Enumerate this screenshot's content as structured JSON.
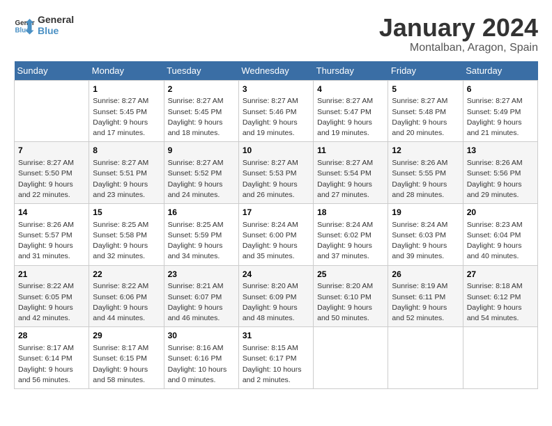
{
  "header": {
    "logo_line1": "General",
    "logo_line2": "Blue",
    "month_year": "January 2024",
    "location": "Montalban, Aragon, Spain"
  },
  "weekdays": [
    "Sunday",
    "Monday",
    "Tuesday",
    "Wednesday",
    "Thursday",
    "Friday",
    "Saturday"
  ],
  "weeks": [
    [
      {
        "day": "",
        "info": ""
      },
      {
        "day": "1",
        "info": "Sunrise: 8:27 AM\nSunset: 5:45 PM\nDaylight: 9 hours\nand 17 minutes."
      },
      {
        "day": "2",
        "info": "Sunrise: 8:27 AM\nSunset: 5:45 PM\nDaylight: 9 hours\nand 18 minutes."
      },
      {
        "day": "3",
        "info": "Sunrise: 8:27 AM\nSunset: 5:46 PM\nDaylight: 9 hours\nand 19 minutes."
      },
      {
        "day": "4",
        "info": "Sunrise: 8:27 AM\nSunset: 5:47 PM\nDaylight: 9 hours\nand 19 minutes."
      },
      {
        "day": "5",
        "info": "Sunrise: 8:27 AM\nSunset: 5:48 PM\nDaylight: 9 hours\nand 20 minutes."
      },
      {
        "day": "6",
        "info": "Sunrise: 8:27 AM\nSunset: 5:49 PM\nDaylight: 9 hours\nand 21 minutes."
      }
    ],
    [
      {
        "day": "7",
        "info": "Sunrise: 8:27 AM\nSunset: 5:50 PM\nDaylight: 9 hours\nand 22 minutes."
      },
      {
        "day": "8",
        "info": "Sunrise: 8:27 AM\nSunset: 5:51 PM\nDaylight: 9 hours\nand 23 minutes."
      },
      {
        "day": "9",
        "info": "Sunrise: 8:27 AM\nSunset: 5:52 PM\nDaylight: 9 hours\nand 24 minutes."
      },
      {
        "day": "10",
        "info": "Sunrise: 8:27 AM\nSunset: 5:53 PM\nDaylight: 9 hours\nand 26 minutes."
      },
      {
        "day": "11",
        "info": "Sunrise: 8:27 AM\nSunset: 5:54 PM\nDaylight: 9 hours\nand 27 minutes."
      },
      {
        "day": "12",
        "info": "Sunrise: 8:26 AM\nSunset: 5:55 PM\nDaylight: 9 hours\nand 28 minutes."
      },
      {
        "day": "13",
        "info": "Sunrise: 8:26 AM\nSunset: 5:56 PM\nDaylight: 9 hours\nand 29 minutes."
      }
    ],
    [
      {
        "day": "14",
        "info": "Sunrise: 8:26 AM\nSunset: 5:57 PM\nDaylight: 9 hours\nand 31 minutes."
      },
      {
        "day": "15",
        "info": "Sunrise: 8:25 AM\nSunset: 5:58 PM\nDaylight: 9 hours\nand 32 minutes."
      },
      {
        "day": "16",
        "info": "Sunrise: 8:25 AM\nSunset: 5:59 PM\nDaylight: 9 hours\nand 34 minutes."
      },
      {
        "day": "17",
        "info": "Sunrise: 8:24 AM\nSunset: 6:00 PM\nDaylight: 9 hours\nand 35 minutes."
      },
      {
        "day": "18",
        "info": "Sunrise: 8:24 AM\nSunset: 6:02 PM\nDaylight: 9 hours\nand 37 minutes."
      },
      {
        "day": "19",
        "info": "Sunrise: 8:24 AM\nSunset: 6:03 PM\nDaylight: 9 hours\nand 39 minutes."
      },
      {
        "day": "20",
        "info": "Sunrise: 8:23 AM\nSunset: 6:04 PM\nDaylight: 9 hours\nand 40 minutes."
      }
    ],
    [
      {
        "day": "21",
        "info": "Sunrise: 8:22 AM\nSunset: 6:05 PM\nDaylight: 9 hours\nand 42 minutes."
      },
      {
        "day": "22",
        "info": "Sunrise: 8:22 AM\nSunset: 6:06 PM\nDaylight: 9 hours\nand 44 minutes."
      },
      {
        "day": "23",
        "info": "Sunrise: 8:21 AM\nSunset: 6:07 PM\nDaylight: 9 hours\nand 46 minutes."
      },
      {
        "day": "24",
        "info": "Sunrise: 8:20 AM\nSunset: 6:09 PM\nDaylight: 9 hours\nand 48 minutes."
      },
      {
        "day": "25",
        "info": "Sunrise: 8:20 AM\nSunset: 6:10 PM\nDaylight: 9 hours\nand 50 minutes."
      },
      {
        "day": "26",
        "info": "Sunrise: 8:19 AM\nSunset: 6:11 PM\nDaylight: 9 hours\nand 52 minutes."
      },
      {
        "day": "27",
        "info": "Sunrise: 8:18 AM\nSunset: 6:12 PM\nDaylight: 9 hours\nand 54 minutes."
      }
    ],
    [
      {
        "day": "28",
        "info": "Sunrise: 8:17 AM\nSunset: 6:14 PM\nDaylight: 9 hours\nand 56 minutes."
      },
      {
        "day": "29",
        "info": "Sunrise: 8:17 AM\nSunset: 6:15 PM\nDaylight: 9 hours\nand 58 minutes."
      },
      {
        "day": "30",
        "info": "Sunrise: 8:16 AM\nSunset: 6:16 PM\nDaylight: 10 hours\nand 0 minutes."
      },
      {
        "day": "31",
        "info": "Sunrise: 8:15 AM\nSunset: 6:17 PM\nDaylight: 10 hours\nand 2 minutes."
      },
      {
        "day": "",
        "info": ""
      },
      {
        "day": "",
        "info": ""
      },
      {
        "day": "",
        "info": ""
      }
    ]
  ]
}
